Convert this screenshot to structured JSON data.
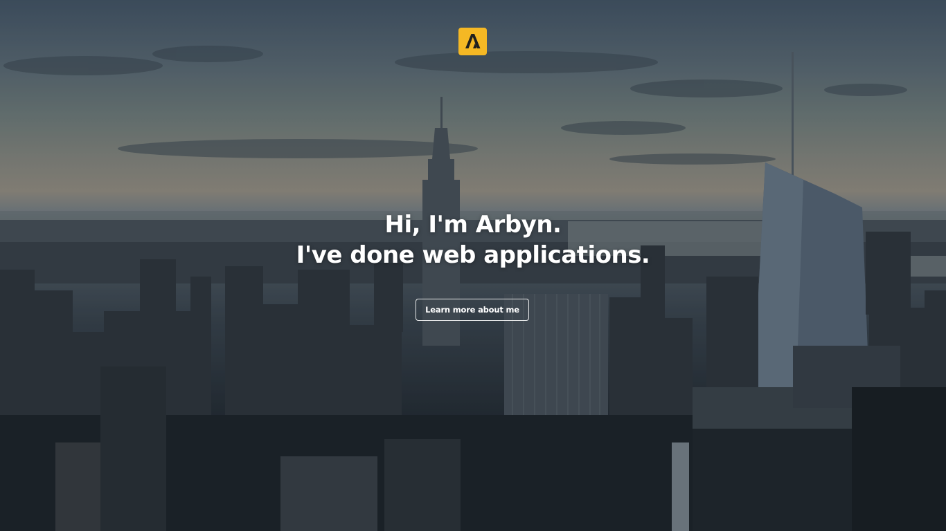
{
  "page": {
    "background_description": "",
    "accent_color": "#f5b824"
  },
  "logo": {
    "icon": "brand-a-logo-icon",
    "color": "#f5b824"
  },
  "hero": {
    "line1": "Hi, I'm Arbyn.",
    "line2": "I've done web applications."
  },
  "cta": {
    "label": "Learn more about me"
  }
}
